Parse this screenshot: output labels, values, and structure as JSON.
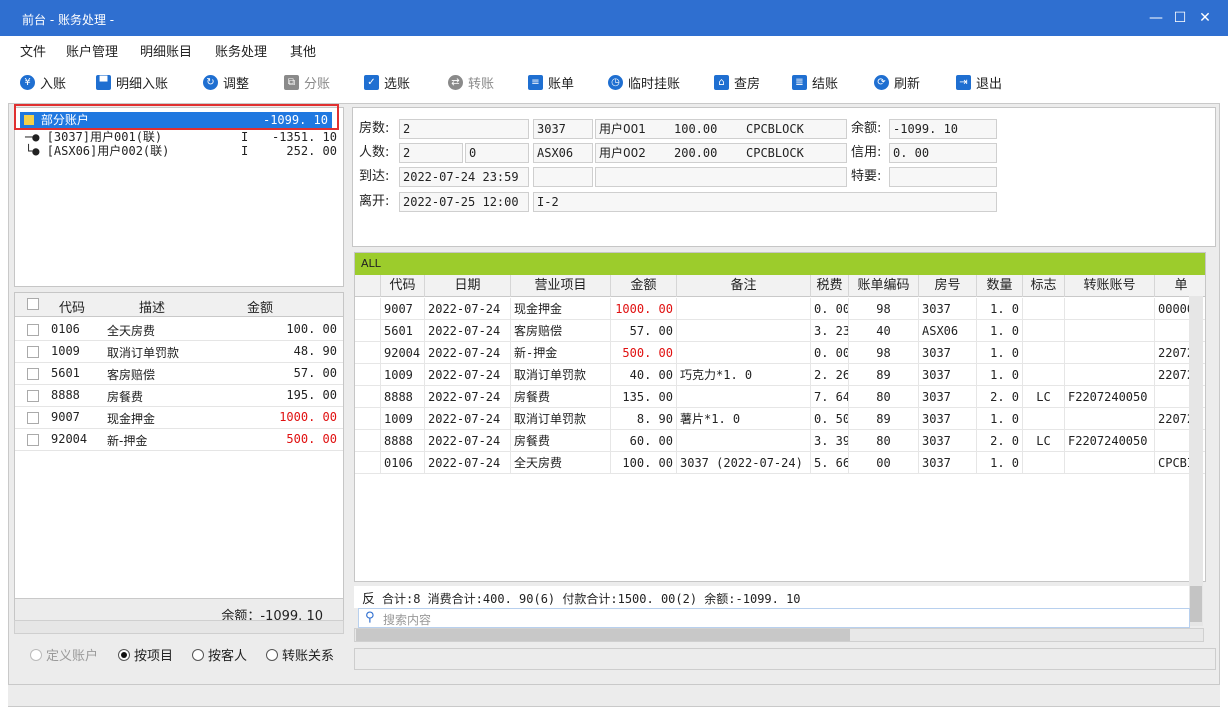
{
  "window": {
    "title": "前台 - 账务处理 -",
    "minimize": "—",
    "maximize": "☐",
    "close": "✕"
  },
  "menu": [
    "文件",
    "账户管理",
    "明细账目",
    "账务处理",
    "其他"
  ],
  "toolbar": {
    "items": [
      {
        "label": "入账",
        "icon": "yen-icon",
        "glyph": "¥",
        "enabled": true
      },
      {
        "label": "明细入账",
        "icon": "monitor-icon",
        "glyph": "▀",
        "enabled": true
      },
      {
        "label": "调整",
        "icon": "adjust-icon",
        "glyph": "↻",
        "enabled": true
      },
      {
        "label": "分账",
        "icon": "copy-icon",
        "glyph": "⧉",
        "enabled": false
      },
      {
        "label": "选账",
        "icon": "select-icon",
        "glyph": "✓",
        "enabled": true
      },
      {
        "label": "转账",
        "icon": "transfer-icon",
        "glyph": "⇄",
        "enabled": false
      },
      {
        "label": "账单",
        "icon": "bill-icon",
        "glyph": "≡",
        "enabled": true
      },
      {
        "label": "临时挂账",
        "icon": "clock-icon",
        "glyph": "◷",
        "enabled": true
      },
      {
        "label": "查房",
        "icon": "house-icon",
        "glyph": "⌂",
        "enabled": true
      },
      {
        "label": "结账",
        "icon": "database-icon",
        "glyph": "≣",
        "enabled": true
      },
      {
        "label": "刷新",
        "icon": "refresh-icon",
        "glyph": "⟳",
        "enabled": true
      },
      {
        "label": "退出",
        "icon": "exit-icon",
        "glyph": "⇥",
        "enabled": true
      }
    ]
  },
  "tree": {
    "root": {
      "label": "部分账户",
      "amount": "-1099. 10"
    },
    "children": [
      {
        "label": "[3037]用户001(联)",
        "flag": "I",
        "amount": "-1351. 10"
      },
      {
        "label": "[ASX06]用户002(联)",
        "flag": "I",
        "amount": "252. 00"
      }
    ]
  },
  "left_table": {
    "headers": [
      "代码",
      "描述",
      "金额"
    ],
    "rows": [
      {
        "code": "0106",
        "desc": "全天房费",
        "amount": "100. 00",
        "red": false
      },
      {
        "code": "1009",
        "desc": "取消订单罚款",
        "amount": "48. 90",
        "red": false
      },
      {
        "code": "5601",
        "desc": "客房赔偿",
        "amount": "57. 00",
        "red": false
      },
      {
        "code": "8888",
        "desc": "房餐费",
        "amount": "195. 00",
        "red": false
      },
      {
        "code": "9007",
        "desc": "现金押金",
        "amount": "1000. 00",
        "red": true
      },
      {
        "code": "92004",
        "desc": "新-押金",
        "amount": "500. 00",
        "red": true
      }
    ],
    "balance": "余额：-1099. 10"
  },
  "view_modes": [
    {
      "label": "定义账户",
      "selected": false,
      "enabled": false
    },
    {
      "label": "按项目",
      "selected": true,
      "enabled": true
    },
    {
      "label": "按客人",
      "selected": false,
      "enabled": true
    },
    {
      "label": "转账关系",
      "selected": false,
      "enabled": true
    }
  ],
  "info": {
    "rooms_label": "房数:",
    "rooms": "2",
    "people_label": "人数:",
    "people": "2",
    "people2": "0",
    "arrive_label": "到达:",
    "arrive": "2022-07-24 23:59",
    "depart_label": "离开:",
    "depart": "2022-07-25 12:00",
    "depart_extra": "I-2",
    "room1": {
      "room": "3037",
      "guest": "用户001",
      "rate": "100.00",
      "code": "CPCBLOCK"
    },
    "room2": {
      "room": "ASX06",
      "guest": "用户002",
      "rate": "200.00",
      "code": "CPCBLOCK"
    },
    "balance_label": "余额:",
    "balance": "-1099. 10",
    "credit_label": "信用:",
    "credit": "0. 00",
    "special_label": "特要:",
    "special": ""
  },
  "grid": {
    "tab": "ALL",
    "headers": [
      "代码",
      "日期",
      "营业项目",
      "金额",
      "备注",
      "税费",
      "账单编码",
      "房号",
      "数量",
      "标志",
      "转账账号",
      "单"
    ],
    "rows": [
      {
        "code": "9007",
        "date": "2022-07-24",
        "item": "现金押金",
        "amount": "1000. 00",
        "red": true,
        "note": "",
        "tax": "0. 00",
        "bill": "98",
        "room": "3037",
        "qty": "1. 0",
        "flag": "",
        "transfer": "",
        "extra": "00000"
      },
      {
        "code": "5601",
        "date": "2022-07-24",
        "item": "客房赔偿",
        "amount": "57. 00",
        "red": false,
        "note": "",
        "tax": "3. 23",
        "bill": "40",
        "room": "ASX06",
        "qty": "1. 0",
        "flag": "",
        "transfer": "",
        "extra": ""
      },
      {
        "code": "92004",
        "date": "2022-07-24",
        "item": "新-押金",
        "amount": "500. 00",
        "red": true,
        "note": "",
        "tax": "0. 00",
        "bill": "98",
        "room": "3037",
        "qty": "1. 0",
        "flag": "",
        "transfer": "",
        "extra": "22072"
      },
      {
        "code": "1009",
        "date": "2022-07-24",
        "item": "取消订单罚款",
        "amount": "40. 00",
        "red": false,
        "note": "巧克力*1. 0",
        "tax": "2. 26",
        "bill": "89",
        "room": "3037",
        "qty": "1. 0",
        "flag": "",
        "transfer": "",
        "extra": "22072"
      },
      {
        "code": "8888",
        "date": "2022-07-24",
        "item": "房餐费",
        "amount": "135. 00",
        "red": false,
        "note": "",
        "tax": "7. 64",
        "bill": "80",
        "room": "3037",
        "qty": "2. 0",
        "flag": "LC",
        "transfer": "F2207240050",
        "extra": ""
      },
      {
        "code": "1009",
        "date": "2022-07-24",
        "item": "取消订单罚款",
        "amount": "8. 90",
        "red": false,
        "note": "薯片*1. 0",
        "tax": "0. 50",
        "bill": "89",
        "room": "3037",
        "qty": "1. 0",
        "flag": "",
        "transfer": "",
        "extra": "22072"
      },
      {
        "code": "8888",
        "date": "2022-07-24",
        "item": "房餐费",
        "amount": "60. 00",
        "red": false,
        "note": "",
        "tax": "3. 39",
        "bill": "80",
        "room": "3037",
        "qty": "2. 0",
        "flag": "LC",
        "transfer": "F2207240050",
        "extra": ""
      },
      {
        "code": "0106",
        "date": "2022-07-24",
        "item": "全天房费",
        "amount": "100. 00",
        "red": false,
        "note": "3037 (2022-07-24)",
        "tax": "5. 66",
        "bill": "00",
        "room": "3037",
        "qty": "1. 0",
        "flag": "",
        "transfer": "",
        "extra": "CPCBI"
      }
    ],
    "summary_reverse": "反",
    "summary": "合计:8  消费合计:400. 90(6)  付款合计:1500. 00(2)  余额:-1099. 10",
    "search_placeholder": "搜索内容"
  },
  "colors": {
    "titlebar": "#2f6fd0",
    "selection": "#1f78e0",
    "tab_bar": "#9ccc2c",
    "highlight_box": "#e03030",
    "negative_red": "#e01010"
  }
}
